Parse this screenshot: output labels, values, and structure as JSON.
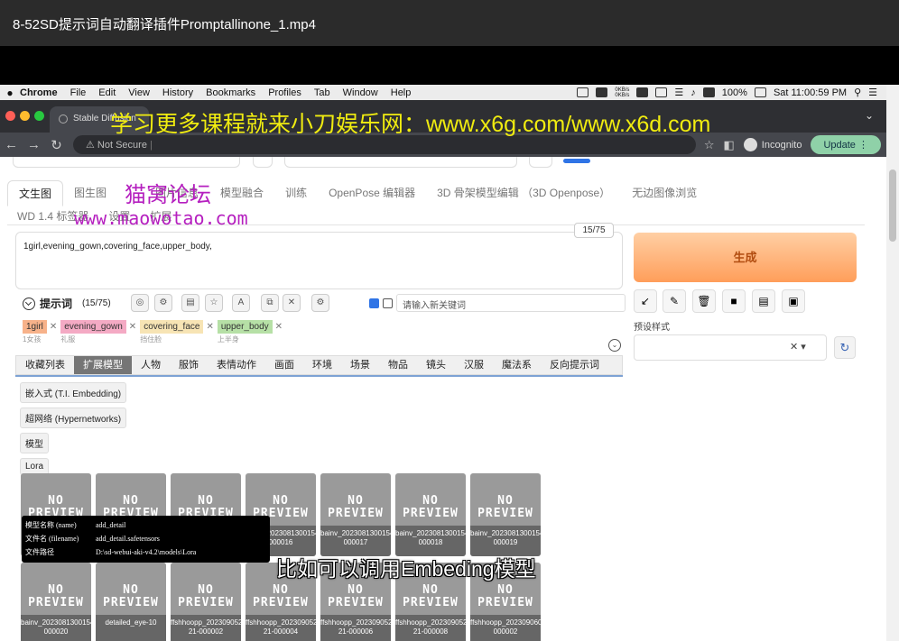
{
  "video": {
    "title": "8-52SD提示词自动翻译插件Promptallinone_1.mp4"
  },
  "menubar": {
    "app": "Chrome",
    "items": [
      "File",
      "Edit",
      "View",
      "History",
      "Bookmarks",
      "Profiles",
      "Tab",
      "Window",
      "Help"
    ],
    "net_up": "0KB/s",
    "net_down": "0KB/s",
    "battery": "100%",
    "clock": "Sat 11:00:59 PM"
  },
  "browser": {
    "tab_title": "Stable Diffusion",
    "address": "Not Secure",
    "profile": "Incognito",
    "update": "Update"
  },
  "watermarks": {
    "banner": "学习更多课程就来小刀娱乐网：www.x6g.com/www.x6d.com",
    "forum": "猫窝论坛",
    "forum_url": "www.maowotao.com"
  },
  "tabs_row1": [
    "文生图",
    "图生图",
    "图片信息",
    "模型融合",
    "训练",
    "OpenPose 编辑器",
    "3D 骨架模型编辑 （3D Openpose）",
    "无边图像浏览"
  ],
  "tabs_row2": [
    "WD 1.4 标签器",
    "设置",
    "扩展"
  ],
  "prompt": {
    "text": "1girl,evening_gown,covering_face,upper_body,",
    "token_count": "15/75"
  },
  "panel": {
    "title": "提示词",
    "count": "(15/75)",
    "keyword_placeholder": "请输入新关键词",
    "tags": [
      {
        "name": "1girl",
        "trans": "1女孩",
        "color": "#f7b28a"
      },
      {
        "name": "evening_gown",
        "trans": "礼服",
        "color": "#f4aac4"
      },
      {
        "name": "covering_face",
        "trans": "挡住脸",
        "color": "#f7e4b4"
      },
      {
        "name": "upper_body",
        "trans": "上半身",
        "color": "#b6e0a6"
      }
    ],
    "categories": [
      "收藏列表",
      "扩展模型",
      "人物",
      "服饰",
      "表情动作",
      "画面",
      "环境",
      "场景",
      "物品",
      "镜头",
      "汉服",
      "魔法系",
      "反向提示词"
    ],
    "active_category": "扩展模型",
    "subtabs": [
      "嵌入式 (T.I. Embedding)",
      "超网络 (Hypernetworks)",
      "模型",
      "Lora"
    ]
  },
  "preview_text": "NO PREVIEW",
  "cards_row1": [
    "",
    "",
    "",
    "bainv_20230813001549-000016",
    "bainv_20230813001549-000017",
    "bainv_20230813001549-000018",
    "bainv_20230813001549-000019"
  ],
  "cards_row2": [
    "bainv_20230813001549-000020",
    "detailed_eye-10",
    "ffshhoopp_202309052349 21-000002",
    "ffshhoopp_202309052349 21-000004",
    "ffshhoopp_202309052349 21-000006",
    "ffshhoopp_202309052349 21-000008",
    "ffshhoopp_20230906000504-000002"
  ],
  "tooltip": {
    "rows": [
      {
        "k": "模型名称 (name)",
        "v": "add_detail"
      },
      {
        "k": "文件名 (filename)",
        "v": "add_detail.safetensors"
      },
      {
        "k": "文件路径",
        "v": "D:\\sd-webui-aki-v4.2\\models\\Lora"
      }
    ]
  },
  "right": {
    "generate": "生成",
    "preset_label": "预设样式"
  },
  "subtitle": "比如可以调用Embeding模型"
}
